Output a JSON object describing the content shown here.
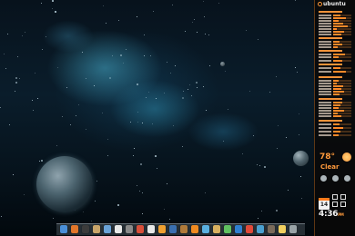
{
  "desktop": {
    "wallpaper": "nebula-space",
    "accent": "#ff9a3c"
  },
  "conky": {
    "logo_text": "ubuntu",
    "weather": {
      "temp": "78°",
      "condition": "Clear",
      "icon": "sun-icon",
      "forecast_icons": [
        "cloud-icon",
        "cloud-icon",
        "cloud-icon"
      ]
    },
    "clock": {
      "time": "4:36",
      "ampm": "PM"
    },
    "calendar": {
      "day": "14"
    }
  },
  "dock": {
    "icons": [
      "globe-icon",
      "firefox-icon",
      "terminal-icon",
      "files-icon",
      "image-viewer-icon",
      "text-editor-icon",
      "settings-icon",
      "mail-icon",
      "calendar-icon",
      "music-icon",
      "video-icon",
      "archive-icon",
      "vlc-icon",
      "photos-icon",
      "folder-icon",
      "chat-icon",
      "browser-icon",
      "chrome-icon",
      "office-icon",
      "gimp-icon",
      "notes-icon",
      "trash-icon"
    ]
  }
}
